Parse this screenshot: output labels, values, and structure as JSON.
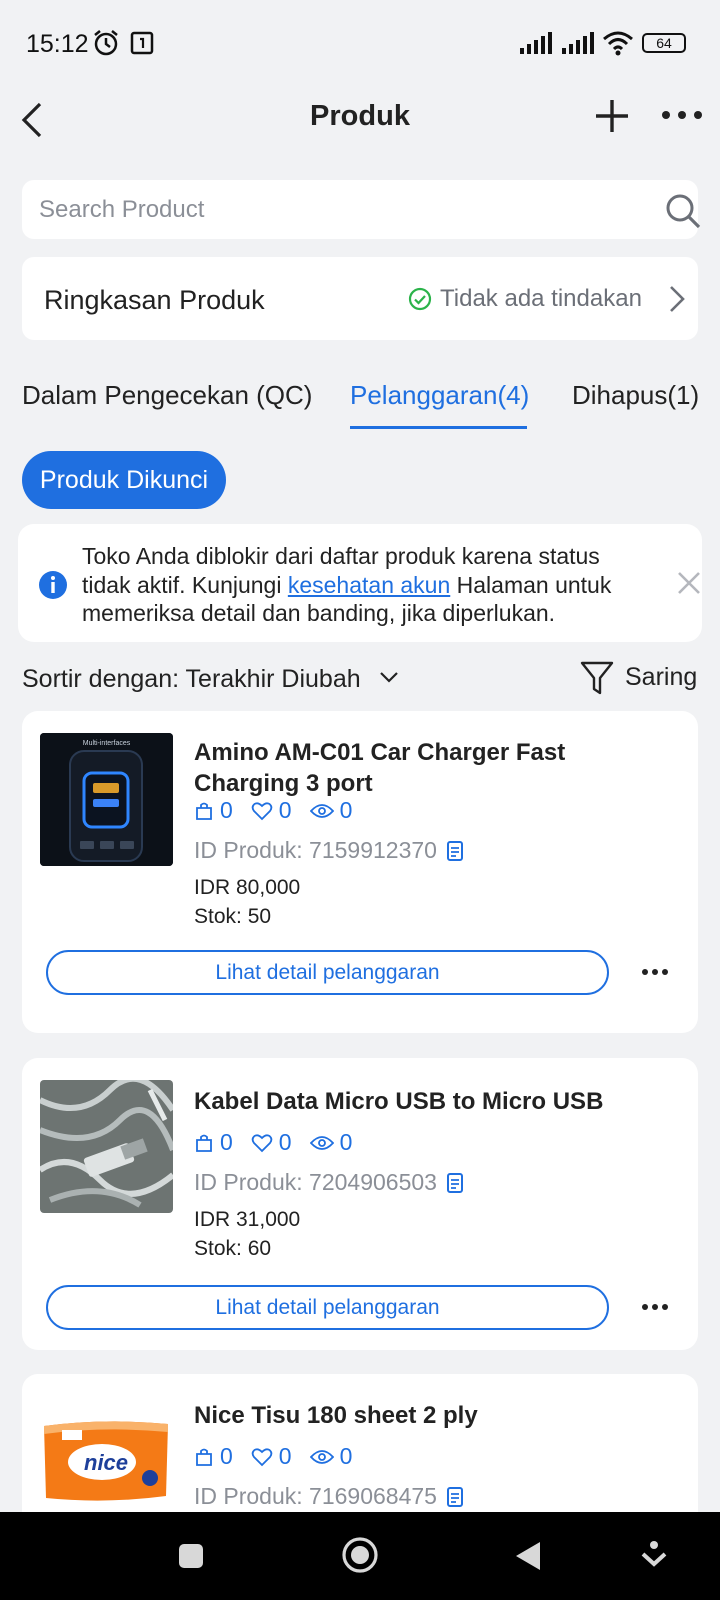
{
  "status_bar": {
    "time": "15:12",
    "battery": "64"
  },
  "header": {
    "title": "Produk"
  },
  "search": {
    "placeholder": "Search Product"
  },
  "summary": {
    "label": "Ringkasan Produk",
    "status": "Tidak ada tindakan"
  },
  "tabs": [
    {
      "label": "Dalam Pengecekan (QC)",
      "active": false
    },
    {
      "label": "Pelanggaran(4)",
      "active": true
    },
    {
      "label": "Dihapus(1)",
      "active": false
    }
  ],
  "filter_chip": {
    "label": "Produk Dikunci"
  },
  "notice": {
    "text_before": "Toko Anda diblokir dari daftar produk karena status tidak aktif. Kunjungi ",
    "link": "kesehatan akun",
    "text_after": " Halaman untuk memeriksa detail dan banding, jika diperlukan."
  },
  "sort": {
    "label": "Sortir dengan: Terakhir Diubah",
    "filter_label": "Saring"
  },
  "products": [
    {
      "name": "Amino AM-C01 Car Charger Fast Charging 3 port",
      "sold": "0",
      "likes": "0",
      "views": "0",
      "id_label": "ID Produk: 7159912370",
      "price": "IDR 80,000",
      "stock": "Stok: 50",
      "button": "Lihat detail pelanggaran",
      "thumb_text": "Multi-interfaces"
    },
    {
      "name": "Kabel Data Micro USB to Micro USB",
      "sold": "0",
      "likes": "0",
      "views": "0",
      "id_label": "ID Produk: 7204906503",
      "price": "IDR 31,000",
      "stock": "Stok: 60",
      "button": "Lihat detail pelanggaran"
    },
    {
      "name": "Nice Tisu 180 sheet 2 ply",
      "sold": "0",
      "likes": "0",
      "views": "0",
      "id_label": "ID Produk: 7169068475",
      "thumb_text": "nice"
    }
  ],
  "colors": {
    "accent": "#1f6fe0",
    "background": "#f1f2f4",
    "success": "#2bb34a"
  }
}
